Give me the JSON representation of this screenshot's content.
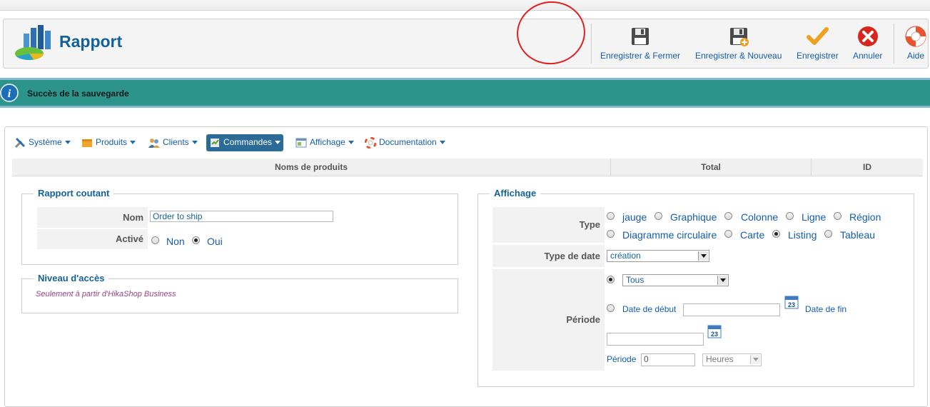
{
  "header": {
    "title": "Rapport",
    "buttons": [
      {
        "id": "save-close",
        "label": "Enregistrer & Fermer",
        "icon": "floppy-icon"
      },
      {
        "id": "save-new",
        "label": "Enregistrer & Nouveau",
        "icon": "floppy-new-icon"
      },
      {
        "id": "save",
        "label": "Enregistrer",
        "icon": "checkmark-icon"
      },
      {
        "id": "cancel",
        "label": "Annuler",
        "icon": "cancel-icon"
      },
      {
        "id": "help",
        "label": "Aide",
        "icon": "lifebuoy-icon"
      }
    ]
  },
  "message": {
    "text": "Succès de la sauvegarde",
    "icon": "info-icon"
  },
  "menu": [
    {
      "label": "Système",
      "icon": "tools-icon"
    },
    {
      "label": "Produits",
      "icon": "box-icon"
    },
    {
      "label": "Clients",
      "icon": "users-icon"
    },
    {
      "label": "Commandes",
      "icon": "orders-icon",
      "active": true
    },
    {
      "label": "Affichage",
      "icon": "display-icon"
    },
    {
      "label": "Documentation",
      "icon": "lifebuoy-icon"
    }
  ],
  "table": {
    "columns": [
      "Noms de produits",
      "Total",
      "ID"
    ]
  },
  "rapport": {
    "legend": "Rapport coutant",
    "nom_label": "Nom",
    "nom_value": "Order to ship",
    "active_label": "Activé",
    "active_options": [
      "Non",
      "Oui"
    ],
    "active_selected": "Oui"
  },
  "acces": {
    "legend": "Niveau d'accès",
    "text": "Seulement à partir d'HikaShop Business"
  },
  "affichage": {
    "legend": "Affichage",
    "type_label": "Type",
    "types": [
      "jauge",
      "Graphique",
      "Colonne",
      "Ligne",
      "Région",
      "Diagramme circulaire",
      "Carte",
      "Listing",
      "Tableau"
    ],
    "type_selected": "Listing",
    "datetype_label": "Type de date",
    "datetype_value": "création",
    "periode_label": "Période",
    "periode_select": "Tous",
    "date_debut_label": "Date de début",
    "date_fin_label": "Date de fin",
    "calendar_icon_text": "23",
    "periode_small_label": "Période",
    "periode_value": "0",
    "unit_value": "Heures"
  },
  "colors": {
    "brand": "#146295",
    "message_bg": "#2d948c",
    "link": "#135cae",
    "annotation": "#e02020"
  }
}
